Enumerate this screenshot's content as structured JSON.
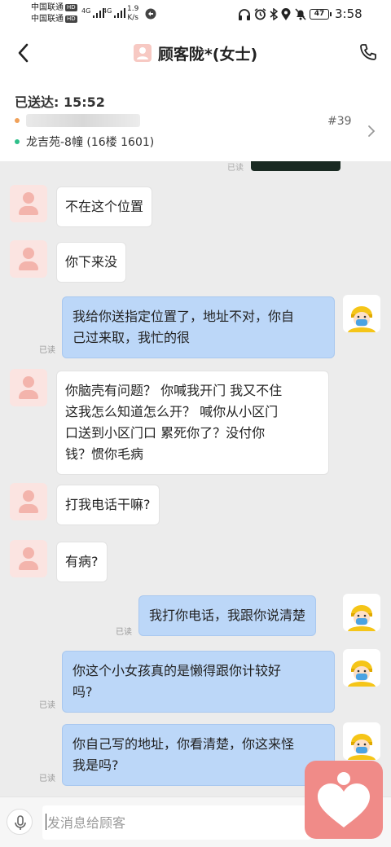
{
  "status_bar": {
    "carrier1": "中国联通",
    "carrier2": "中国联通",
    "hd1": "HD",
    "hd2": "HD",
    "signal1": "4G",
    "signal2": "4G",
    "speed_value": "1.9",
    "speed_unit": "K/s",
    "battery": "47",
    "time": "3:58"
  },
  "header": {
    "title": "顾客陇*(女士)"
  },
  "order": {
    "sent_label": "已送达: 15:52",
    "address": "龙吉苑-8幢 (16楼 1601)",
    "order_no": "#39",
    "dot_colors": [
      "#f0a15a",
      "#2fbf8a"
    ]
  },
  "prev_read": "已读",
  "messages": [
    {
      "side": "left",
      "text": "不在这个位置"
    },
    {
      "side": "left",
      "text": "你下来没"
    },
    {
      "side": "right",
      "lines": [
        "我给你送指定位置了，地址不对，你自",
        "己过来取，我忙的很"
      ],
      "read": "已读"
    },
    {
      "side": "left",
      "lines": [
        "你脑壳有问题？ 你喊我开门 我又不住",
        "这我怎么知道怎么开？ 喊你从小区门",
        "口送到小区门口 累死你了？没付你",
        "钱？惯你毛病"
      ]
    },
    {
      "side": "left",
      "text": "打我电话干嘛?"
    },
    {
      "side": "left",
      "text": "有病?"
    },
    {
      "side": "right",
      "text": "我打你电话，我跟你说清楚",
      "read": "已读"
    },
    {
      "side": "right",
      "lines": [
        "你这个小女孩真的是懒得跟你计较好",
        "吗?"
      ],
      "read": "已读"
    },
    {
      "side": "right",
      "lines": [
        "你自己写的地址，你看清楚，你这来怪",
        "我是吗?"
      ],
      "read": "已读"
    }
  ],
  "input": {
    "placeholder": "发消息给顾客"
  },
  "colors": {
    "bubble_right": "#bcd7f8",
    "bubble_left": "#ffffff",
    "background": "#ececec",
    "fab": "#f08b88"
  }
}
